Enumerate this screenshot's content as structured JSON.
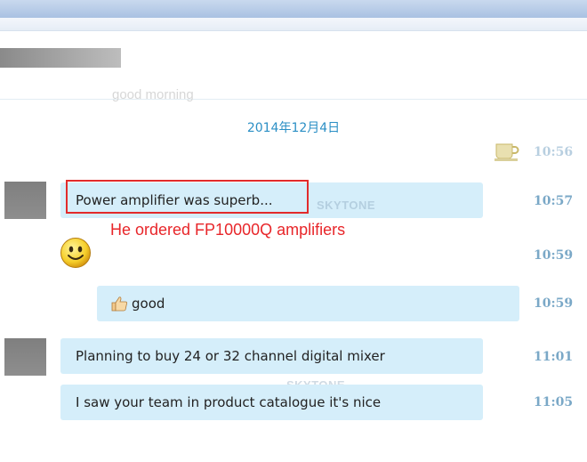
{
  "header": {
    "faded_message": "good morning"
  },
  "date_separator": "2014年12月4日",
  "messages": [
    {
      "text": "Power amplifier was superb...",
      "time": "10:57"
    },
    {
      "time": "10:59",
      "icon": "smiley-icon"
    },
    {
      "text": "good",
      "time": "10:59",
      "icon": "thumbs-up-icon"
    },
    {
      "text": "Planning to buy 24 or 32 channel digital mixer",
      "time": "11:01"
    },
    {
      "text": "I saw your team in product catalogue it's nice",
      "time": "11:05"
    }
  ],
  "annotation": "He ordered FP10000Q amplifiers",
  "watermark": "SKYTONE",
  "colors": {
    "bubble": "#d5eefa",
    "time": "#7aa8c7",
    "date": "#2b8fc5",
    "annotation": "#e8262a"
  }
}
